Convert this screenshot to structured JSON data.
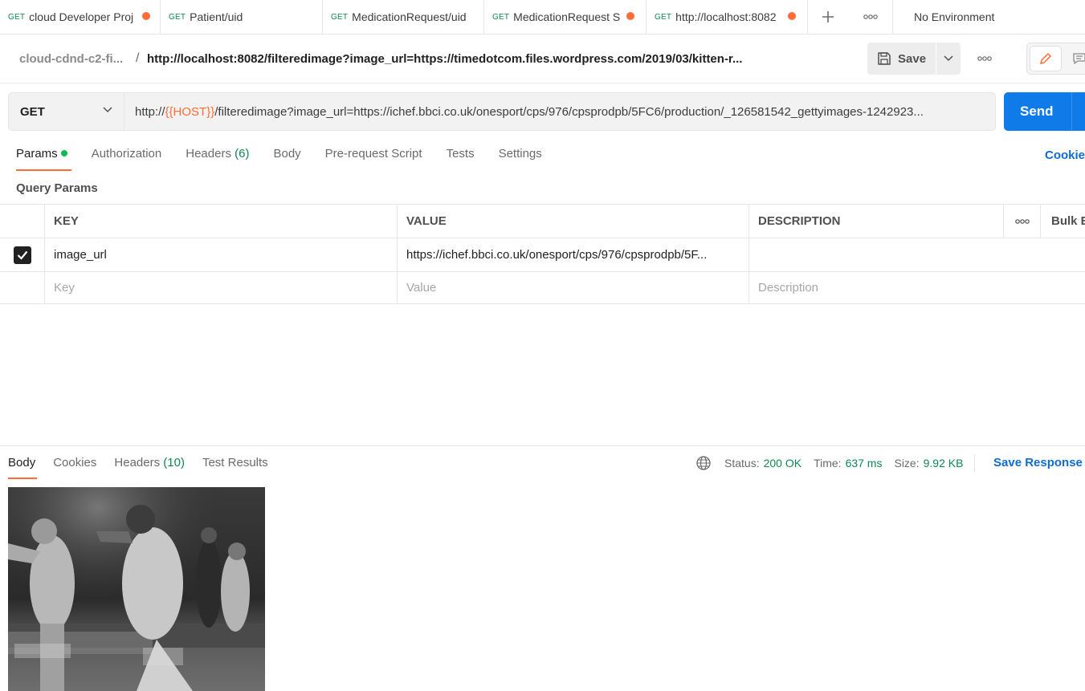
{
  "tabs": [
    {
      "method": "GET",
      "title": "cloud Developer Proj",
      "unsaved": true
    },
    {
      "method": "GET",
      "title": "Patient/uid",
      "unsaved": false
    },
    {
      "method": "GET",
      "title": "MedicationRequest/uid",
      "unsaved": false
    },
    {
      "method": "GET",
      "title": "MedicationRequest S",
      "unsaved": true
    },
    {
      "method": "GET",
      "title": "http://localhost:8082",
      "unsaved": true
    }
  ],
  "environment": "No Environment",
  "breadcrumb": {
    "collection": "cloud-cdnd-c2-fi...",
    "separator": "/",
    "request_name": "http://localhost:8082/filteredimage?image_url=https://timedotcom.files.wordpress.com/2019/03/kitten-r..."
  },
  "toolbar": {
    "save_label": "Save"
  },
  "request": {
    "method": "GET",
    "url_prefix": "http://",
    "url_var": "{{HOST}}",
    "url_rest": "/filteredimage?image_url=https://ichef.bbci.co.uk/onesport/cps/976/cpsprodpb/5FC6/production/_126581542_gettyimages-1242923...",
    "send_label": "Send"
  },
  "request_tabs": {
    "params": "Params",
    "authorization": "Authorization",
    "headers": "Headers",
    "headers_count": "(6)",
    "body": "Body",
    "prerequest": "Pre-request Script",
    "tests": "Tests",
    "settings": "Settings",
    "cookies": "Cookies"
  },
  "query_params": {
    "title": "Query Params",
    "columns": {
      "key": "KEY",
      "value": "VALUE",
      "description": "DESCRIPTION",
      "bulk": "Bulk Edit"
    },
    "rows": [
      {
        "checked": true,
        "key": "image_url",
        "value": "https://ichef.bbci.co.uk/onesport/cps/976/cpsprodpb/5F...",
        "description": ""
      }
    ],
    "placeholders": {
      "key": "Key",
      "value": "Value",
      "description": "Description"
    }
  },
  "response": {
    "tabs": {
      "body": "Body",
      "cookies": "Cookies",
      "headers": "Headers",
      "headers_count": "(10)",
      "test_results": "Test Results"
    },
    "status_label": "Status:",
    "status_value": "200 OK",
    "time_label": "Time:",
    "time_value": "637 ms",
    "size_label": "Size:",
    "size_value": "9.92 KB",
    "save_label": "Save Response"
  },
  "colors": {
    "accent": "#ff6c37",
    "primary": "#0f7be8",
    "success": "#0f8a4f"
  }
}
